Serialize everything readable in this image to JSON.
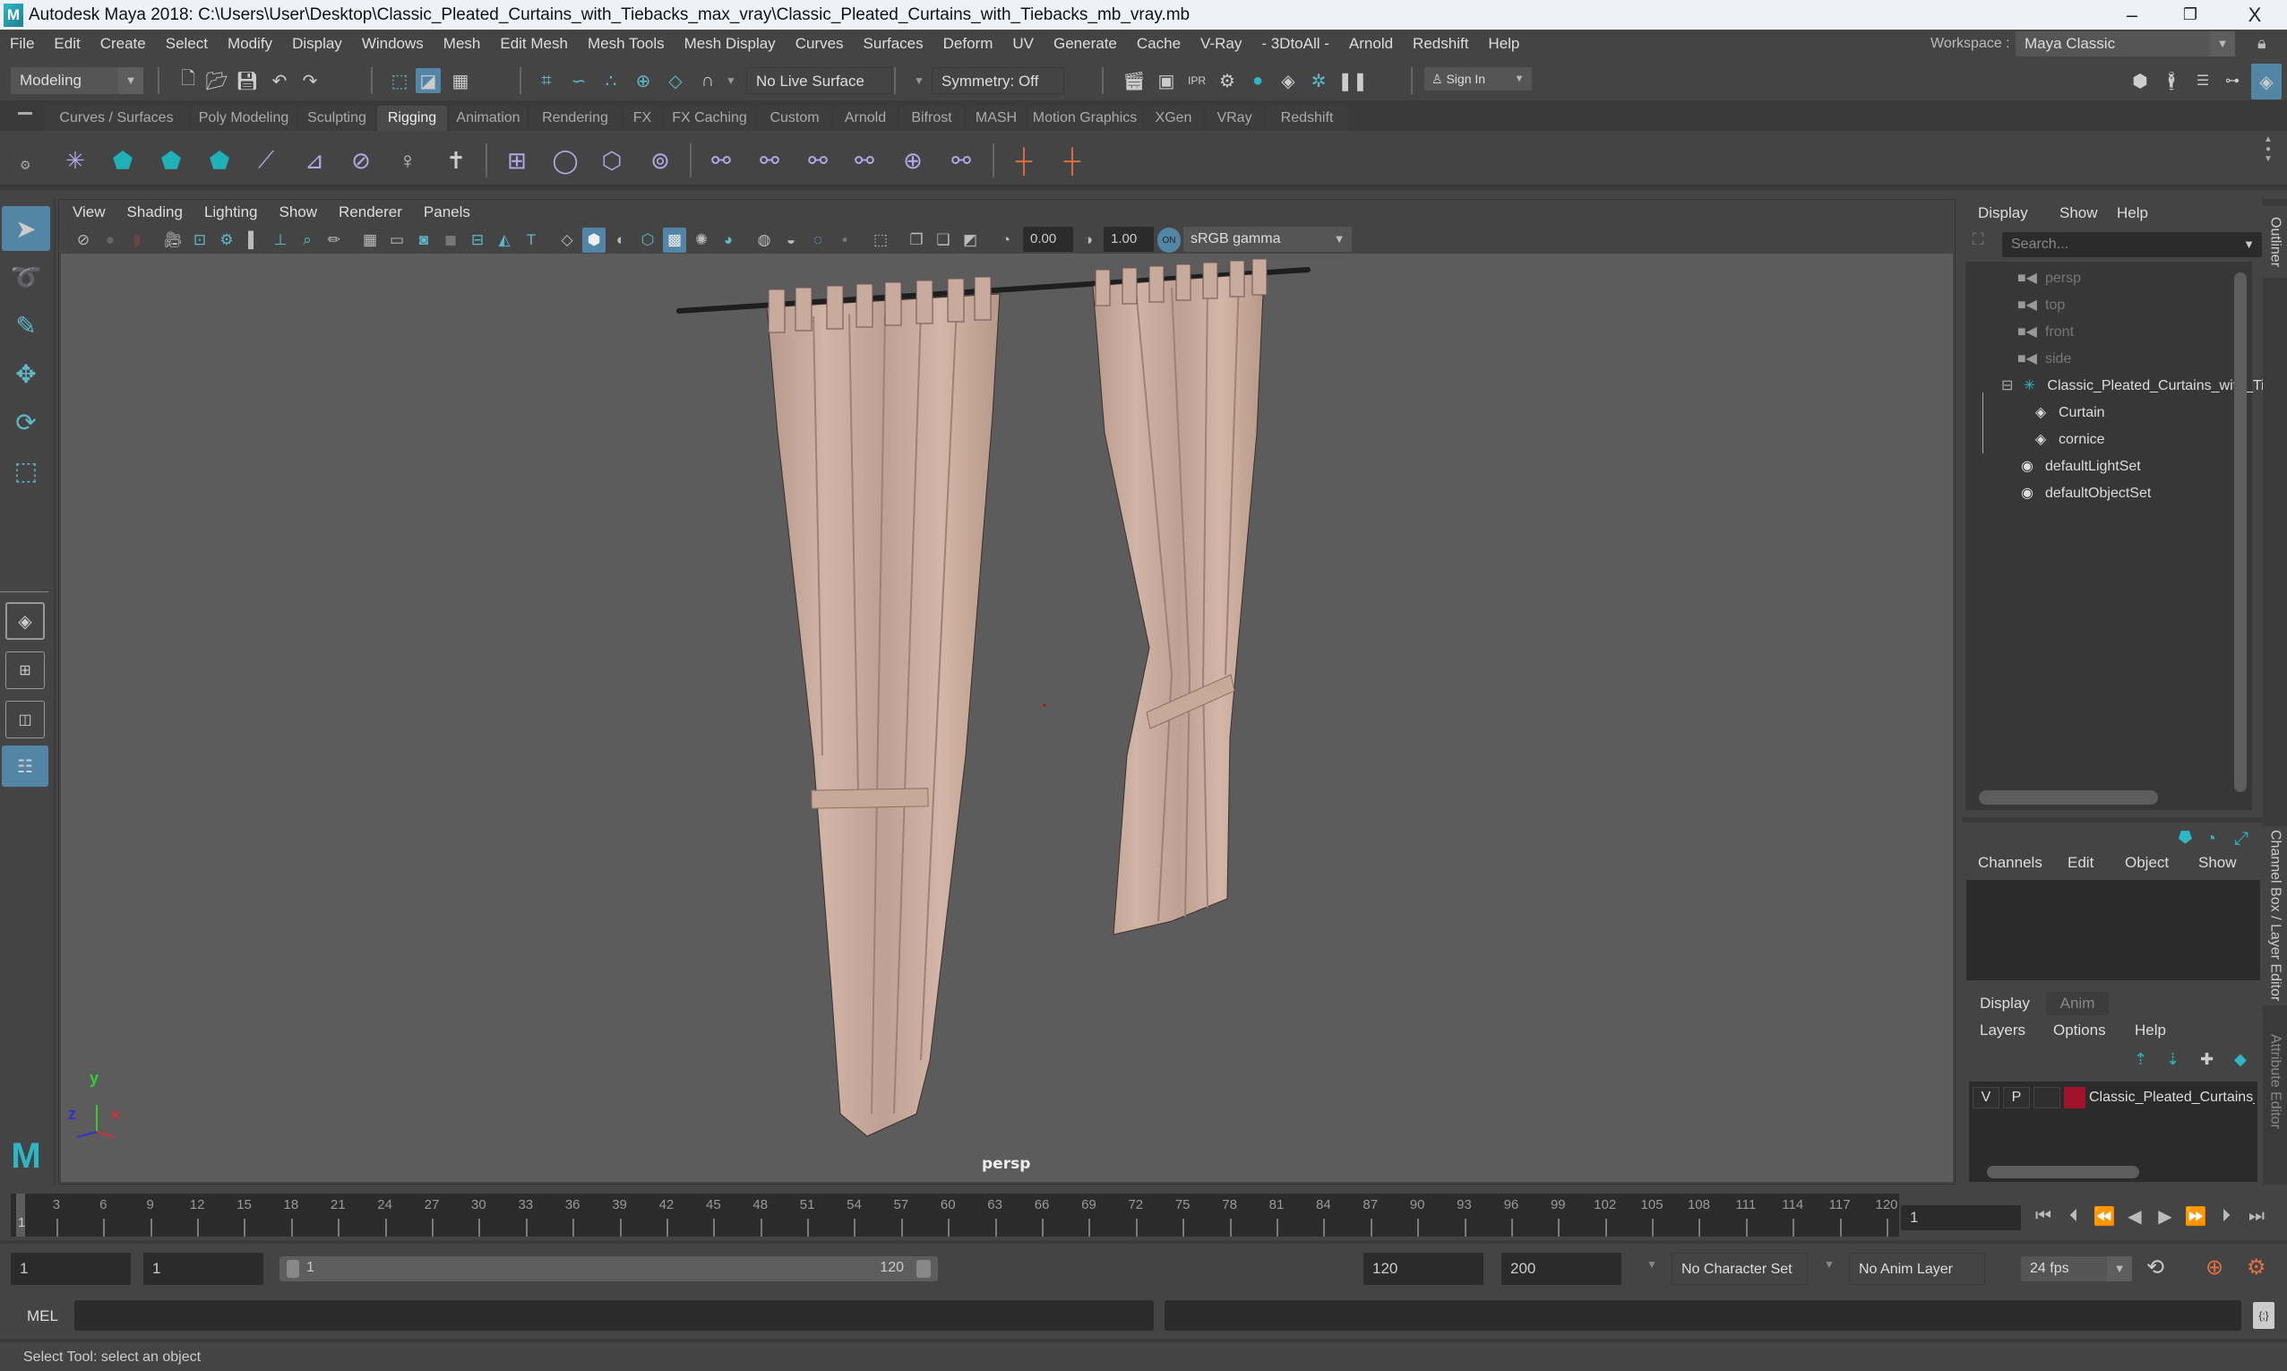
{
  "window": {
    "title": "Autodesk Maya 2018: C:\\Users\\User\\Desktop\\Classic_Pleated_Curtains_with_Tiebacks_max_vray\\Classic_Pleated_Curtains_with_Tiebacks_mb_vray.mb",
    "logo": "M",
    "controls": {
      "minimize": "–",
      "maximize": "❐",
      "close": "X"
    }
  },
  "menubar": {
    "items": [
      "File",
      "Edit",
      "Create",
      "Select",
      "Modify",
      "Display",
      "Windows",
      "Mesh",
      "Edit Mesh",
      "Mesh Tools",
      "Mesh Display",
      "Curves",
      "Surfaces",
      "Deform",
      "UV",
      "Generate",
      "Cache",
      "V-Ray",
      "- 3DtoAll -",
      "Arnold",
      "Redshift",
      "Help"
    ],
    "workspace_label": "Workspace :",
    "workspace_value": "Maya Classic"
  },
  "statusline": {
    "menuset": "Modeling",
    "live_surface": "No Live Surface",
    "symmetry": "Symmetry: Off",
    "sign_in": "Sign In"
  },
  "shelf": {
    "tabs": [
      "Curves / Surfaces",
      "Poly Modeling",
      "Sculpting",
      "Rigging",
      "Animation",
      "Rendering",
      "FX",
      "FX Caching",
      "Custom",
      "Arnold",
      "Bifrost",
      "MASH",
      "Motion Graphics",
      "XGen",
      "VRay",
      "Redshift"
    ],
    "active_tab": "Rigging"
  },
  "viewport": {
    "menu": [
      "View",
      "Shading",
      "Lighting",
      "Show",
      "Renderer",
      "Panels"
    ],
    "exposure": "0.00",
    "gamma": "1.00",
    "color_space": "sRGB gamma",
    "camera_label": "persp",
    "axis": {
      "x": "x",
      "y": "y",
      "z": "z"
    }
  },
  "outliner": {
    "menu": [
      "Display",
      "Show",
      "Help"
    ],
    "search_placeholder": "Search...",
    "items": [
      {
        "label": "persp",
        "icon": "camera-icon",
        "dim": true
      },
      {
        "label": "top",
        "icon": "camera-icon",
        "dim": true
      },
      {
        "label": "front",
        "icon": "camera-icon",
        "dim": true
      },
      {
        "label": "side",
        "icon": "camera-icon",
        "dim": true
      },
      {
        "label": "Classic_Pleated_Curtains_with_Tiebacks",
        "icon": "group-icon",
        "dim": false
      },
      {
        "label": "Curtain",
        "icon": "mesh-icon",
        "dim": false
      },
      {
        "label": "cornice",
        "icon": "mesh-icon",
        "dim": false
      },
      {
        "label": "defaultLightSet",
        "icon": "set-icon",
        "dim": false
      },
      {
        "label": "defaultObjectSet",
        "icon": "set-icon",
        "dim": false
      }
    ]
  },
  "channelbox": {
    "menu": [
      "Channels",
      "Edit",
      "Object",
      "Show"
    ]
  },
  "layereditor": {
    "tabs": [
      "Display",
      "Anim"
    ],
    "menu": [
      "Layers",
      "Options",
      "Help"
    ],
    "layer": {
      "v": "V",
      "p": "P",
      "name": "Classic_Pleated_Curtains_with_Tiebacks",
      "color": "#a0132a"
    }
  },
  "sidetabs": [
    "Outliner",
    "Channel Box / Layer Editor",
    "Attribute Editor"
  ],
  "timeline": {
    "ticks": [
      3,
      6,
      9,
      12,
      15,
      18,
      21,
      24,
      27,
      30,
      33,
      36,
      39,
      42,
      45,
      48,
      51,
      54,
      57,
      60,
      63,
      66,
      69,
      72,
      75,
      78,
      81,
      84,
      87,
      90,
      93,
      96,
      99,
      102,
      105,
      108,
      111,
      114,
      117,
      120
    ],
    "start": 1,
    "end": 120,
    "current_frame_label": "1",
    "current_frame": "1"
  },
  "range": {
    "start_time": "1",
    "playback_start": "1",
    "slider_start": "1",
    "slider_end": "120",
    "playback_end": "120",
    "end_time": "200",
    "character_set": "No Character Set",
    "anim_layer": "No Anim Layer",
    "fps": "24 fps"
  },
  "commandline": {
    "label": "MEL",
    "value": ""
  },
  "helpline": {
    "text": "Select Tool: select an object"
  },
  "colors": {
    "accent": "#5285a6",
    "teal": "#2fb6c6",
    "curtain": "#c9aa9c",
    "rod": "#1e1e1e",
    "layer_red": "#a0132a"
  }
}
